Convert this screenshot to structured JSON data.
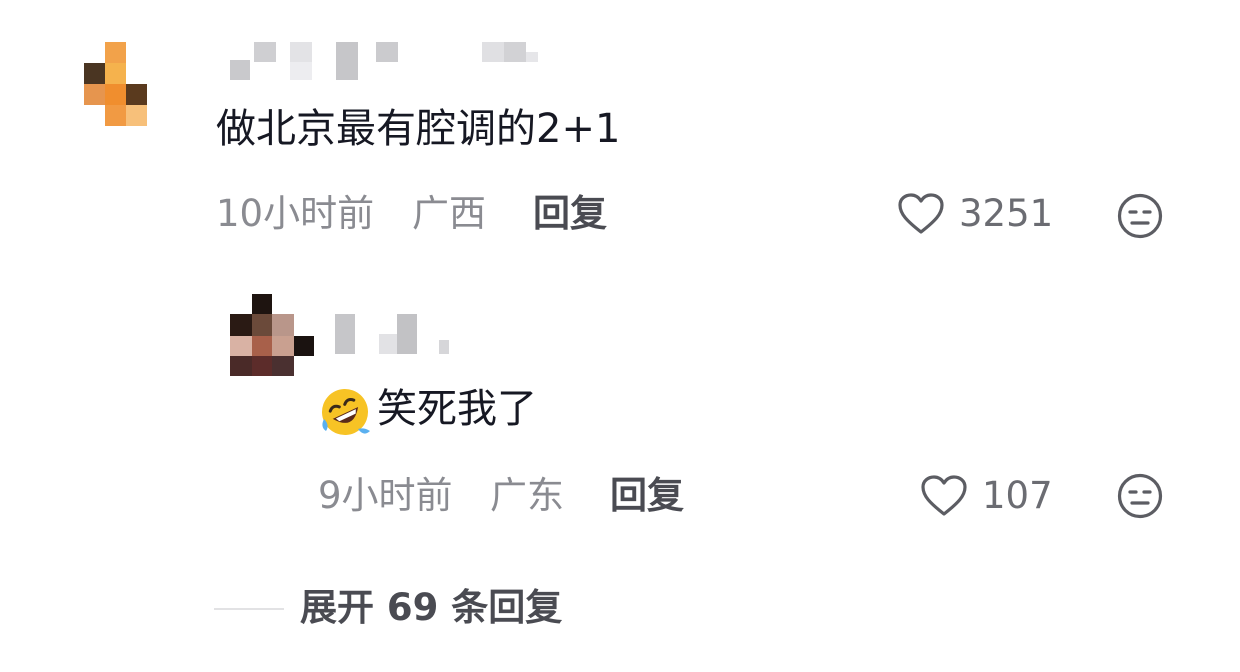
{
  "comment": {
    "username": "",
    "text": "做北京最有腔调的2+1",
    "time": "10小时前",
    "location": "广西",
    "reply_label": "回复",
    "likes": "3251",
    "like_icon": "heart-outline-icon",
    "dislike_icon": "neutral-face-icon"
  },
  "reply": {
    "username": "",
    "emoji": "rolling-on-floor-laughing-emoji",
    "text": "笑死我了",
    "time": "9小时前",
    "location": "广东",
    "reply_label": "回复",
    "likes": "107",
    "like_icon": "heart-outline-icon",
    "dislike_icon": "neutral-face-icon"
  },
  "expand_replies": {
    "label": "展开 69 条回复"
  }
}
